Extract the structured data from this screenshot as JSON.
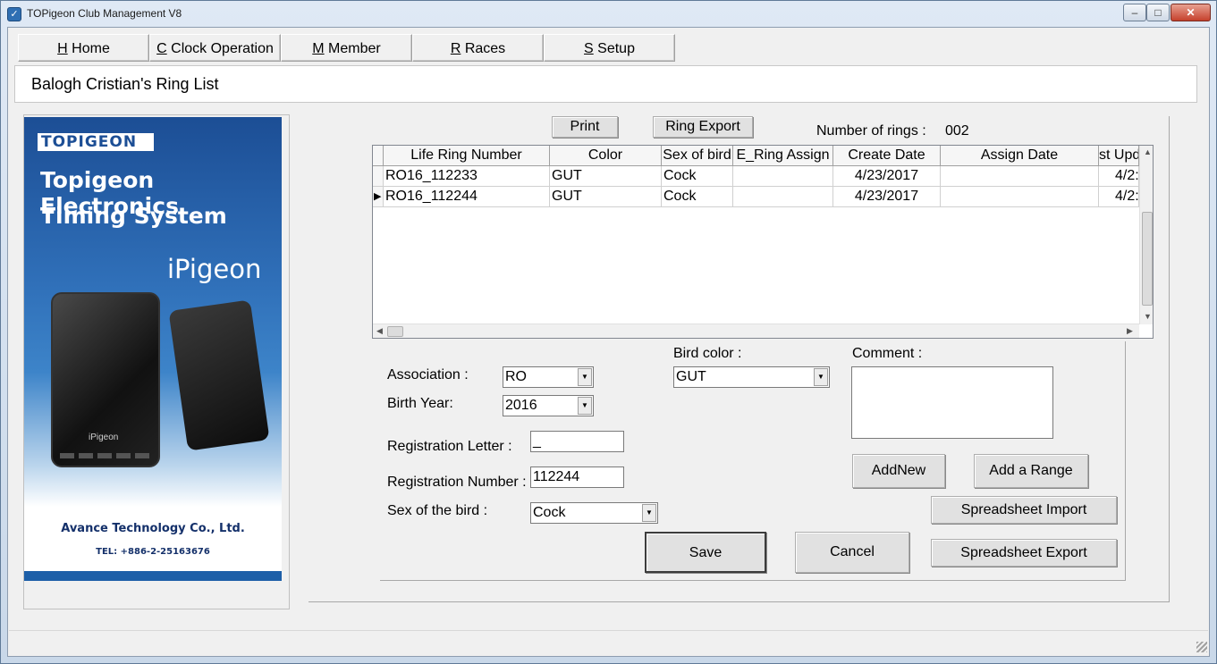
{
  "window": {
    "title": "TOPigeon Club Management V8",
    "controls": {
      "minimize": "–",
      "maximize": "□",
      "close": "✕"
    }
  },
  "menu": [
    {
      "key": "H",
      "label": "Home"
    },
    {
      "key": "C",
      "label": "Clock Operation"
    },
    {
      "key": "M",
      "label": "Member"
    },
    {
      "key": "R",
      "label": "Races"
    },
    {
      "key": "S",
      "label": "Setup"
    }
  ],
  "header": {
    "title": "Balogh Cristian's Ring List"
  },
  "banner": {
    "logo_text": "TOPIGEON",
    "headline_line1": "Topigeon Electronics",
    "headline_line2": "Timing System",
    "product": "iPigeon",
    "device_label": "iPigeon",
    "company": "Avance Technology Co., Ltd.",
    "phone": "TEL: +886-2-25163676"
  },
  "toolbar": {
    "print_label": "Print",
    "ring_export_label": "Ring Export",
    "rings_count_label": "Number of rings :",
    "rings_count_value": "002"
  },
  "grid": {
    "columns": [
      "Life Ring Number",
      "Color",
      "Sex of bird",
      "E_Ring Assign",
      "Create Date",
      "Assign Date",
      "st Upd"
    ],
    "rows": [
      {
        "indicator": "",
        "cells": [
          "RO16_112233",
          "GUT",
          "Cock",
          "",
          "4/23/2017",
          "",
          "4/2:"
        ]
      },
      {
        "indicator": "▶",
        "cells": [
          "RO16_112244",
          "GUT",
          "Cock",
          "",
          "4/23/2017",
          "",
          "4/2:"
        ]
      }
    ]
  },
  "form": {
    "association_label": "Association :",
    "association_value": "RO",
    "birth_year_label": "Birth Year:",
    "birth_year_value": "2016",
    "bird_color_label": "Bird color :",
    "bird_color_value": "GUT",
    "comment_label": "Comment :",
    "comment_value": "",
    "registration_letter_label": "Registration Letter :",
    "registration_letter_value": "_",
    "registration_number_label": "Registration Number :",
    "registration_number_value": "112244",
    "sex_label": "Sex of the bird :",
    "sex_value": "Cock"
  },
  "actions": {
    "addnew": "AddNew",
    "add_range": "Add a Range",
    "spreadsheet_import": "Spreadsheet Import",
    "save": "Save",
    "cancel": "Cancel",
    "spreadsheet_export": "Spreadsheet Export"
  }
}
